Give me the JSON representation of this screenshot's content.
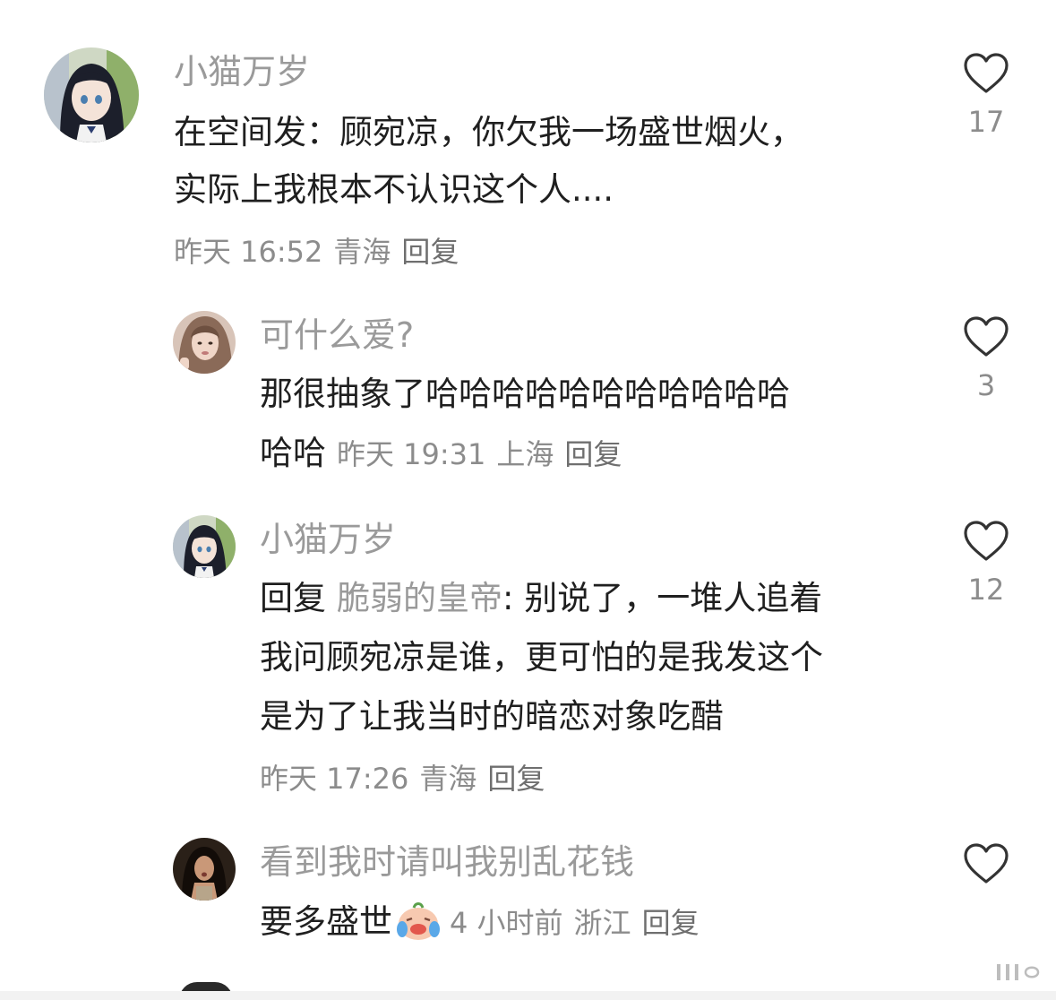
{
  "comments": [
    {
      "username": "小猫万岁",
      "lines": [
        "在空间发：顾宛凉，你欠我一场盛世烟火，",
        "实际上我根本不认识这个人...."
      ],
      "meta": {
        "time": "昨天 16:52",
        "location": "青海",
        "reply": "回复"
      },
      "likes": "17"
    },
    {
      "username": "可什么爱?",
      "lines": [
        "那很抽象了哈哈哈哈哈哈哈哈哈哈哈",
        "哈哈"
      ],
      "meta": {
        "time": "昨天 19:31",
        "location": "上海",
        "reply": "回复"
      },
      "likes": "3"
    },
    {
      "username": "小猫万岁",
      "reply_prefix": "回复",
      "reply_to": "脆弱的皇帝",
      "lines": [
        ": 别说了，一堆人追着",
        "我问顾宛凉是谁，更可怕的是我发这个",
        "是为了让我当时的暗恋对象吃醋"
      ],
      "meta": {
        "time": "昨天 17:26",
        "location": "青海",
        "reply": "回复"
      },
      "likes": "12"
    },
    {
      "username": "看到我时请叫我别乱花钱",
      "lines": [
        "要多盛世"
      ],
      "emoji": "crying-laughing-baby-emoji",
      "meta": {
        "time": "4 小时前",
        "location": "浙江",
        "reply": "回复"
      },
      "likes": ""
    }
  ],
  "icons": {
    "like": "heart-outline-icon"
  },
  "colors": {
    "username": "#9a9a9a",
    "text": "#1f1f1f",
    "meta": "#8c8c8c"
  }
}
